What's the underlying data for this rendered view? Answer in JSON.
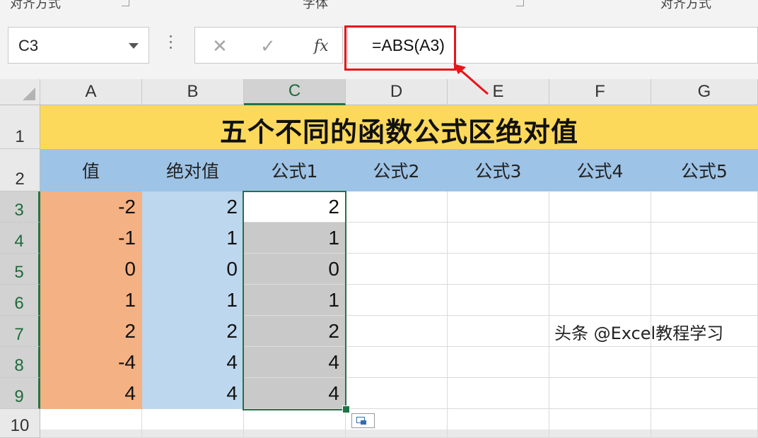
{
  "ribbon": {
    "group_1_label": "对齐方式",
    "group_2_label": "字体",
    "group_3_label": "对齐方式"
  },
  "formula_bar": {
    "name_box": "C3",
    "cancel_symbol": "✕",
    "enter_symbol": "✓",
    "fx_symbol": "fx",
    "formula": "=ABS(A3)"
  },
  "columns": [
    "A",
    "B",
    "C",
    "D",
    "E",
    "F",
    "G"
  ],
  "selected_column": "C",
  "rows": [
    "1",
    "2",
    "3",
    "4",
    "5",
    "6",
    "7",
    "8",
    "9",
    "10"
  ],
  "selected_rows": [
    "3",
    "4",
    "5",
    "6",
    "7",
    "8",
    "9"
  ],
  "sheet": {
    "title": "五个不同的函数公式区绝对值",
    "headers": [
      "值",
      "绝对值",
      "公式1",
      "公式2",
      "公式3",
      "公式4",
      "公式5"
    ],
    "values": [
      "-2",
      "-1",
      "0",
      "1",
      "2",
      "-4",
      "4"
    ],
    "abs_values": [
      "2",
      "1",
      "0",
      "1",
      "2",
      "4",
      "4"
    ],
    "formula1_results": [
      "2",
      "1",
      "0",
      "1",
      "2",
      "4",
      "4"
    ]
  },
  "colors": {
    "title_fill": "#fdd95b",
    "header_fill": "#9dc3e6",
    "value_fill": "#f4b183",
    "abs_fill": "#bdd7ee",
    "formula_fill": "#c9c9c9",
    "selection": "#217346",
    "highlight_box": "#e8151b"
  },
  "watermark": "头条 @Excel教程学习"
}
